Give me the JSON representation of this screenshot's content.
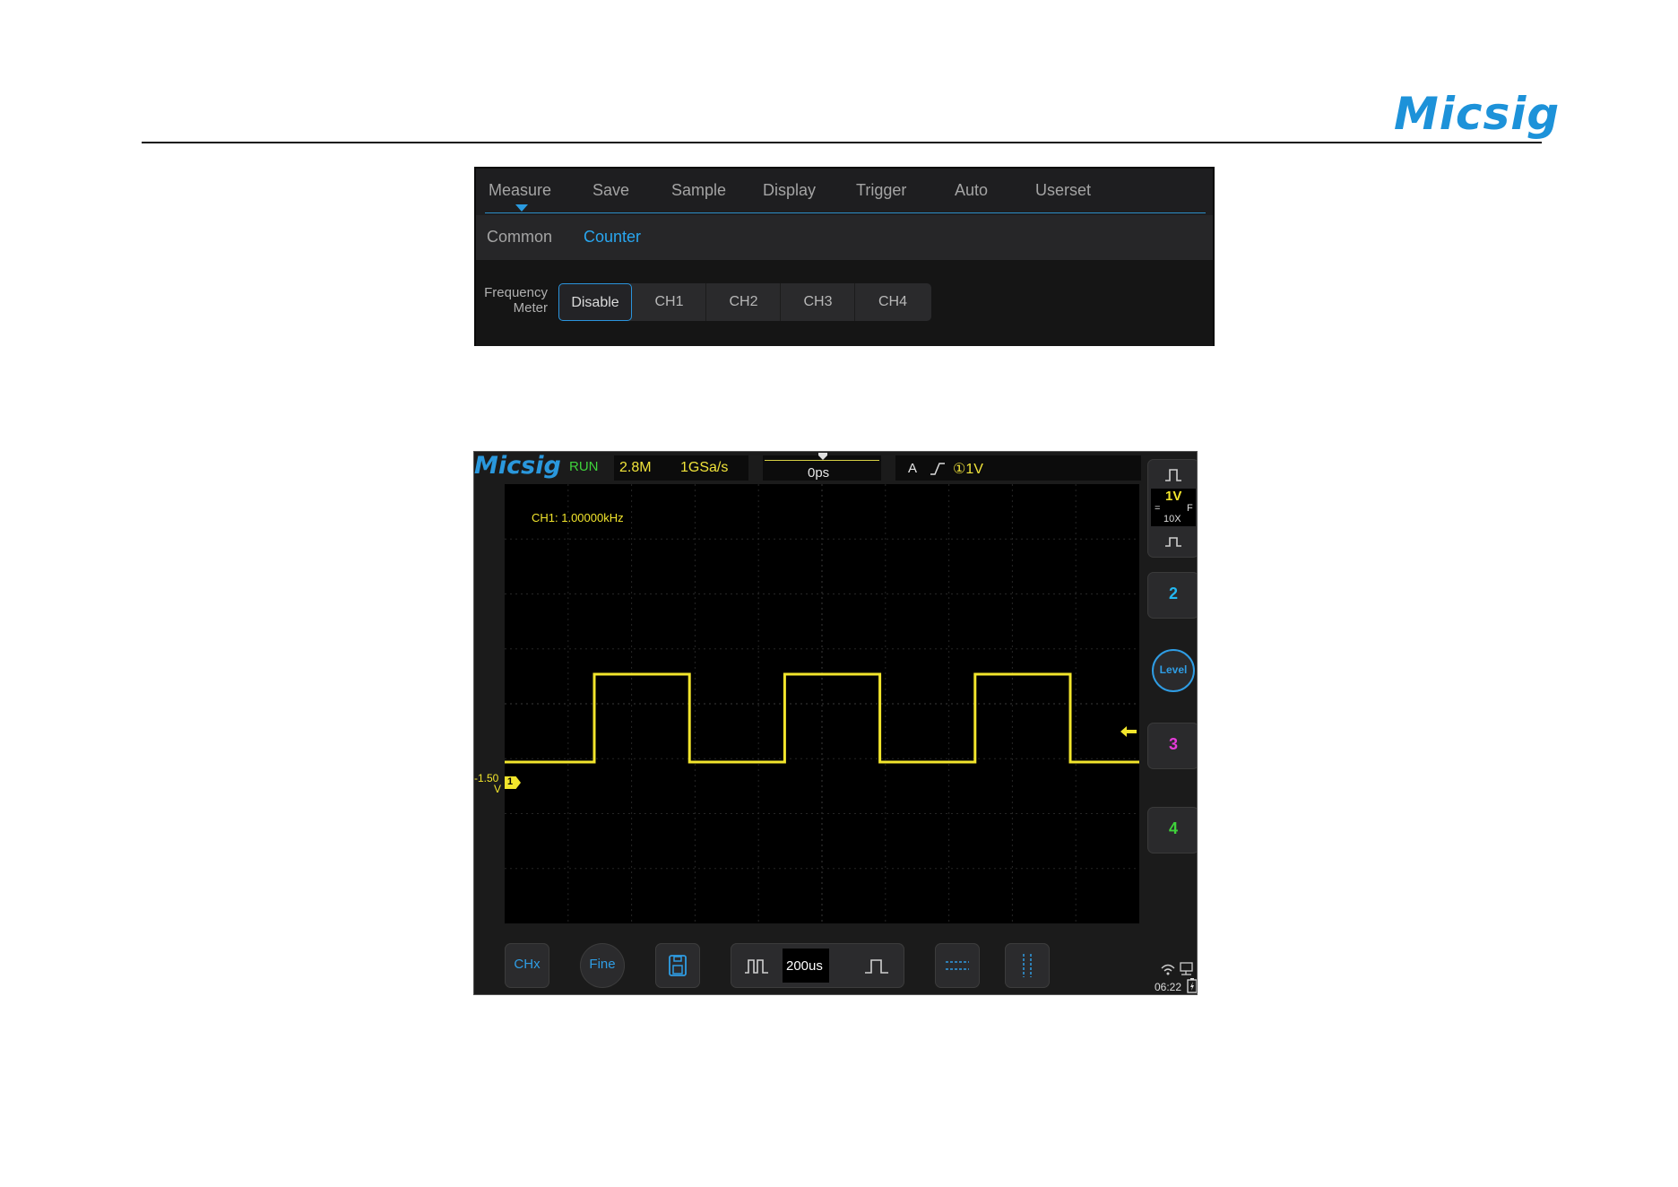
{
  "brand": {
    "logo": "Micsig"
  },
  "menu": {
    "tabs": [
      "Measure",
      "Save",
      "Sample",
      "Display",
      "Trigger",
      "Auto",
      "Userset"
    ],
    "subtabs": [
      "Common",
      "Counter"
    ],
    "active_subtab": "Counter",
    "frequency_meter": {
      "label_line1": "Frequency",
      "label_line2": "Meter",
      "options": [
        "Disable",
        "CH1",
        "CH2",
        "CH3",
        "CH4"
      ],
      "selected": "Disable"
    }
  },
  "scope": {
    "logo": "Micsig",
    "status": "RUN",
    "memory_depth": "2.8M",
    "sample_rate": "1GSa/s",
    "time_offset": "0ps",
    "trigger": {
      "mode": "A",
      "source": "①1V"
    },
    "measurement": "CH1: 1.00000kHz",
    "channel1": {
      "scale": "1V",
      "coupling_left": "=",
      "coupling_right": "F",
      "probe": "10X",
      "offset": "-1.50",
      "offset_unit": "V",
      "marker": "1"
    },
    "channels": [
      {
        "label": "2",
        "color": "#23b7f0"
      },
      {
        "label": "3",
        "color": "#e43bd8"
      },
      {
        "label": "4",
        "color": "#3fd23b"
      }
    ],
    "level_button": "Level",
    "timebase": "200us",
    "bottom_buttons": {
      "chx": "CHx",
      "fine": "Fine"
    },
    "clock": "06:22",
    "waveform": {
      "frequency_khz": 1.0,
      "high_div": 1.0,
      "low_div": 0.0,
      "period_div": 2.0
    },
    "colors": {
      "ch1": "#f2e52c",
      "accent": "#2a98dd"
    }
  }
}
